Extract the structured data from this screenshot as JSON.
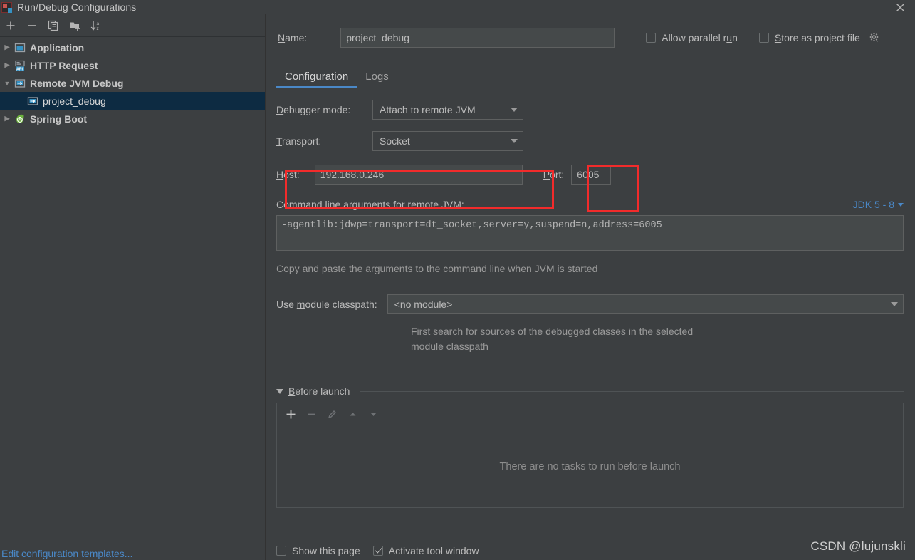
{
  "window": {
    "title": "Run/Debug Configurations",
    "app_icon": "intellij-idea-icon",
    "close_icon": "close-icon"
  },
  "sidebar": {
    "toolbar": [
      {
        "name": "add-configuration-button",
        "icon": "plus-icon",
        "tooltip": "Add New Configuration"
      },
      {
        "name": "remove-configuration-button",
        "icon": "minus-icon",
        "tooltip": "Remove Configuration"
      },
      {
        "name": "copy-configuration-button",
        "icon": "copy-icon",
        "tooltip": "Copy Configuration"
      },
      {
        "name": "save-configuration-button",
        "icon": "folder-add-icon",
        "tooltip": "Save Configuration"
      },
      {
        "name": "sort-configurations-button",
        "icon": "sort-alphabetically-icon",
        "tooltip": "Sort Configurations"
      }
    ],
    "tree": [
      {
        "label": "Application",
        "icon": "application-icon",
        "expanded": false,
        "level": 0,
        "selected": false
      },
      {
        "label": "HTTP Request",
        "icon": "http-request-icon",
        "expanded": false,
        "level": 0,
        "selected": false
      },
      {
        "label": "Remote JVM Debug",
        "icon": "remote-jvm-icon",
        "expanded": true,
        "level": 0,
        "selected": false
      },
      {
        "label": "project_debug",
        "icon": "remote-jvm-icon",
        "expanded": null,
        "level": 1,
        "selected": true
      },
      {
        "label": "Spring Boot",
        "icon": "spring-boot-icon",
        "expanded": false,
        "level": 0,
        "selected": false
      }
    ],
    "edit_templates_link": "Edit configuration templates..."
  },
  "header": {
    "name_label": "Name:",
    "name_value": "project_debug",
    "allow_parallel_run_label": "Allow parallel run",
    "allow_parallel_run_checked": false,
    "store_as_project_file_label": "Store as project file",
    "store_as_project_file_checked": false,
    "store_gear_icon": "gear-icon"
  },
  "tabs": [
    {
      "label": "Configuration",
      "active": true
    },
    {
      "label": "Logs",
      "active": false
    }
  ],
  "configuration": {
    "debugger_mode_label": "Debugger mode:",
    "debugger_mode_value": "Attach to remote JVM",
    "transport_label": "Transport:",
    "transport_value": "Socket",
    "host_label": "Host:",
    "host_value": "192.168.0.246",
    "port_label": "Port:",
    "port_value": "6005",
    "args_label": "Command line arguments for remote JVM:",
    "jdk_selector_label": "JDK 5 - 8",
    "args_value": "-agentlib:jdwp=transport=dt_socket,server=y,suspend=n,address=6005",
    "args_hint": "Copy and paste the arguments to the command line when JVM is started",
    "module_classpath_label": "Use module classpath:",
    "module_classpath_value": "<no module>",
    "module_hint_line1": "First search for sources of the debugged classes in the selected",
    "module_hint_line2": "module classpath"
  },
  "before_launch": {
    "title": "Before launch",
    "expanded": true,
    "toolbar": [
      {
        "name": "add-task-button",
        "icon": "plus-icon",
        "enabled": true
      },
      {
        "name": "remove-task-button",
        "icon": "minus-icon",
        "enabled": false
      },
      {
        "name": "edit-task-button",
        "icon": "pencil-icon",
        "enabled": false
      },
      {
        "name": "move-up-button",
        "icon": "arrow-up-icon",
        "enabled": false
      },
      {
        "name": "move-down-button",
        "icon": "arrow-down-icon",
        "enabled": false
      }
    ],
    "empty_text": "There are no tasks to run before launch"
  },
  "footer": {
    "show_this_page_label": "Show this page",
    "show_this_page_checked": false,
    "activate_tool_window_label": "Activate tool window",
    "activate_tool_window_checked": true
  },
  "watermark": "CSDN @lujunskli",
  "colors": {
    "background": "#3c3f41",
    "field_background": "#45494a",
    "selection": "#0d2b42",
    "accent_link": "#4a88c7",
    "annotation_red": "#f22b2b",
    "text": "#bbbbbb"
  }
}
